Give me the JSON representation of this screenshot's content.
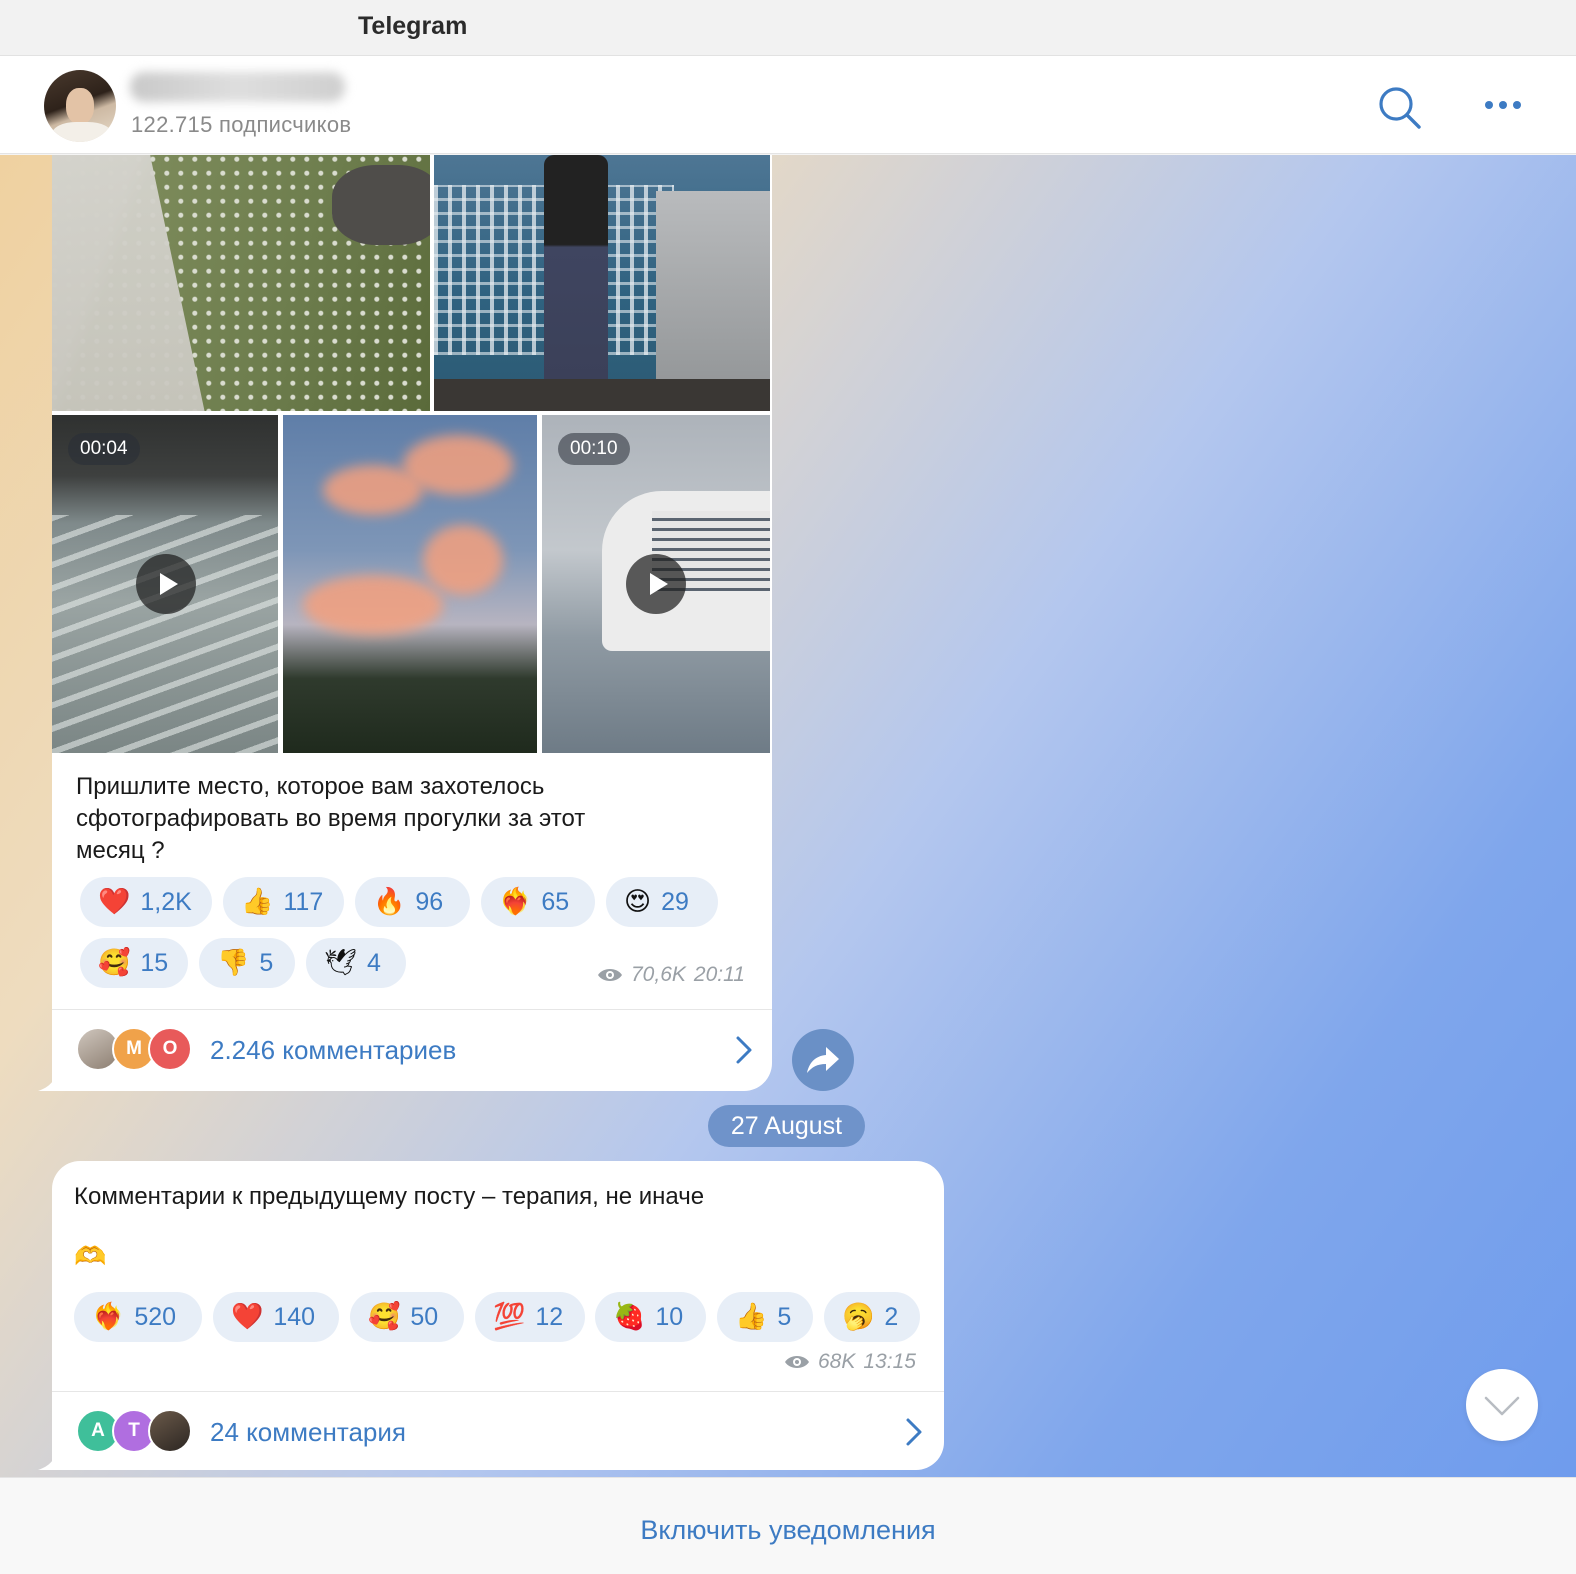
{
  "app": {
    "title": "Telegram"
  },
  "channel": {
    "subscribers": "122.715 подписчиков"
  },
  "post1": {
    "media": [
      {
        "type": "photo"
      },
      {
        "type": "photo"
      },
      {
        "type": "video",
        "duration": "00:04"
      },
      {
        "type": "photo"
      },
      {
        "type": "video",
        "duration": "00:10"
      }
    ],
    "text": [
      "Пришлите место, которое вам захотелось",
      "сфотографировать во время прогулки за этот",
      "месяц ?"
    ],
    "reactions": [
      {
        "emoji": "❤️",
        "count": "1,2K"
      },
      {
        "emoji": "👍",
        "count": "117"
      },
      {
        "emoji": "🔥",
        "count": "96"
      },
      {
        "emoji": "❤️‍🔥",
        "count": "65"
      },
      {
        "emoji": "😍",
        "count": "29"
      },
      {
        "emoji": "🥰",
        "count": "15"
      },
      {
        "emoji": "👎",
        "count": "5"
      },
      {
        "emoji": "🕊",
        "count": "4"
      }
    ],
    "views": "70,6K",
    "time": "20:11",
    "comment_avatars": [
      "",
      "М",
      "О"
    ],
    "comments_label": "2.246 комментариев"
  },
  "date_separator": "27 August",
  "post2": {
    "text": "Комментарии к предыдущему посту – терапия, не иначе",
    "text_emoji": "🫶",
    "reactions": [
      {
        "emoji": "❤️‍🔥",
        "count": "520"
      },
      {
        "emoji": "❤️",
        "count": "140"
      },
      {
        "emoji": "🥰",
        "count": "50"
      },
      {
        "emoji": "💯",
        "count": "12"
      },
      {
        "emoji": "🍓",
        "count": "10"
      },
      {
        "emoji": "👍",
        "count": "5"
      },
      {
        "emoji": "🥱",
        "count": "2"
      }
    ],
    "views": "68K",
    "time": "13:15",
    "comment_avatars": [
      "А",
      "Т",
      ""
    ],
    "comments_label": "24 комментария"
  },
  "footer": {
    "notify_label": "Включить уведомления"
  },
  "colors": {
    "accent": "#3d7bc3",
    "reaction_bg": "#e7eef7",
    "date_pill": "#6f93ca"
  },
  "icons": [
    "search-icon",
    "more-icon",
    "eye-icon",
    "chevron-right-icon",
    "share-icon",
    "chevron-down-icon",
    "play-icon"
  ]
}
